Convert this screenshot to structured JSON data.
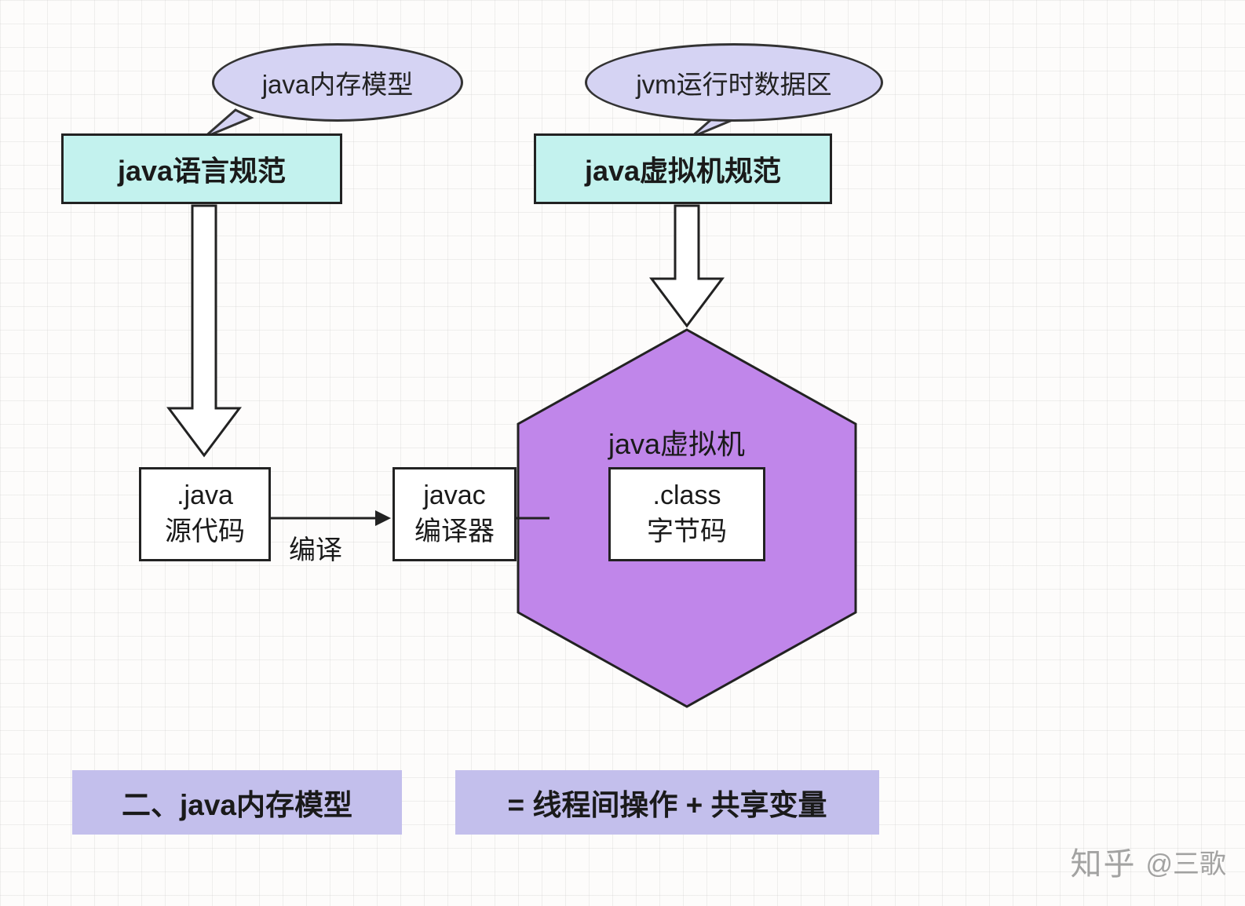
{
  "bubbles": {
    "left": "java内存模型",
    "right": "jvm运行时数据区"
  },
  "specs": {
    "left": "java语言规范",
    "right": "java虚拟机规范"
  },
  "flow": {
    "java": {
      "line1": ".java",
      "line2": "源代码"
    },
    "javac": {
      "line1": "javac",
      "line2": "编译器"
    },
    "classfile": {
      "line1": ".class",
      "line2": "字节码"
    },
    "compile_label": "编译"
  },
  "jvm": {
    "title": "java虚拟机"
  },
  "footer": {
    "left": "二、java内存模型",
    "right": "= 线程间操作  + 共享变量"
  },
  "watermark": {
    "brand": "知乎",
    "author": "@三歌"
  }
}
